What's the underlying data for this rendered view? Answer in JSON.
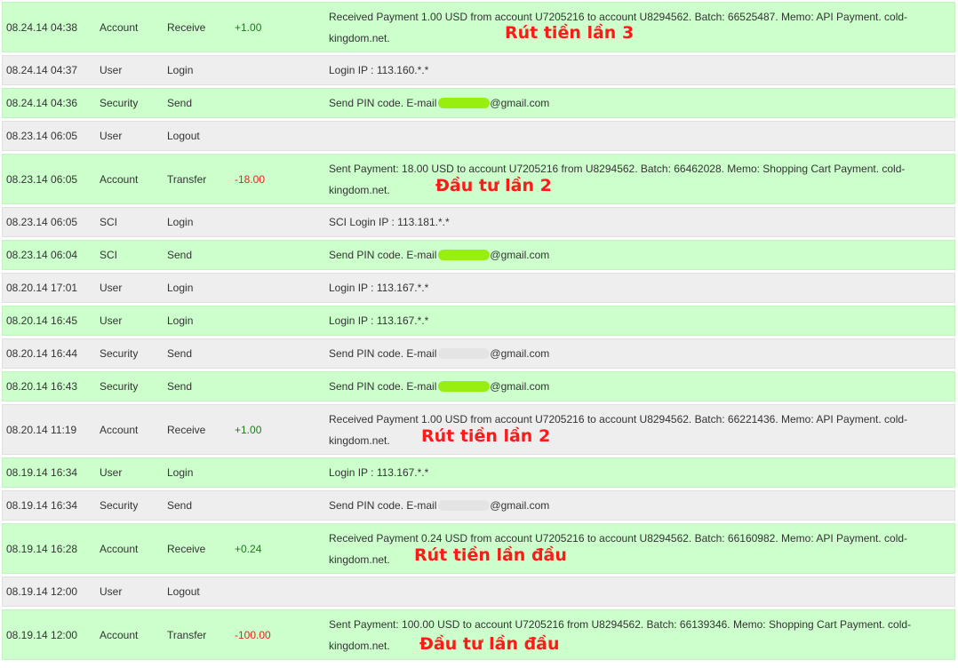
{
  "rows": [
    {
      "date": "08.24.14 04:38",
      "type": "Account",
      "action": "Receive",
      "amount": "+1.00",
      "amount_sign": "pos",
      "line1": "Received Payment 1.00 USD from account U7205216 to account U8294562. Batch: 66525487. Memo: API Payment. cold-",
      "line2": "kingdom.net.",
      "note": "Rút tiền lần 3"
    },
    {
      "date": "08.24.14 04:37",
      "type": "User",
      "action": "Login",
      "amount": "",
      "desc": "Login IP : 113.160.*.*"
    },
    {
      "date": "08.24.14 04:36",
      "type": "Security",
      "action": "Send",
      "amount": "",
      "desc_prefix": "Send PIN code. E-mail ",
      "desc_suffix": "@gmail.com"
    },
    {
      "date": "08.23.14 06:05",
      "type": "User",
      "action": "Logout",
      "amount": "",
      "desc": ""
    },
    {
      "date": "08.23.14 06:05",
      "type": "Account",
      "action": "Transfer",
      "amount": "-18.00",
      "amount_sign": "neg",
      "line1": "Sent Payment: 18.00 USD to account U7205216 from U8294562. Batch: 66462028. Memo: Shopping Cart Payment. cold-",
      "line2": "kingdom.net.",
      "note": "Đầu tư lần 2"
    },
    {
      "date": "08.23.14 06:05",
      "type": "SCI",
      "action": "Login",
      "amount": "",
      "desc": "SCI Login IP : 113.181.*.*"
    },
    {
      "date": "08.23.14 06:04",
      "type": "SCI",
      "action": "Send",
      "amount": "",
      "desc_prefix": "Send PIN code. E-mail ",
      "desc_suffix": "@gmail.com"
    },
    {
      "date": "08.20.14 17:01",
      "type": "User",
      "action": "Login",
      "amount": "",
      "desc": "Login IP : 113.167.*.*"
    },
    {
      "date": "08.20.14 16:45",
      "type": "User",
      "action": "Login",
      "amount": "",
      "desc": "Login IP : 113.167.*.*"
    },
    {
      "date": "08.20.14 16:44",
      "type": "Security",
      "action": "Send",
      "amount": "",
      "desc_prefix": "Send PIN code. E-mail ",
      "desc_suffix": "@gmail.com"
    },
    {
      "date": "08.20.14 16:43",
      "type": "Security",
      "action": "Send",
      "amount": "",
      "desc_prefix": "Send PIN code. E-mail ",
      "desc_suffix": "@gmail.com"
    },
    {
      "date": "08.20.14 11:19",
      "type": "Account",
      "action": "Receive",
      "amount": "+1.00",
      "amount_sign": "pos",
      "line1": "Received Payment 1.00 USD from account U7205216 to account U8294562. Batch: 66221436. Memo: API Payment. cold-",
      "line2": "kingdom.net.",
      "note": "Rút tiền lần 2"
    },
    {
      "date": "08.19.14 16:34",
      "type": "User",
      "action": "Login",
      "amount": "",
      "desc": "Login IP : 113.167.*.*"
    },
    {
      "date": "08.19.14 16:34",
      "type": "Security",
      "action": "Send",
      "amount": "",
      "desc_prefix": "Send PIN code. E-mail ",
      "desc_suffix": "@gmail.com"
    },
    {
      "date": "08.19.14 16:28",
      "type": "Account",
      "action": "Receive",
      "amount": "+0.24",
      "amount_sign": "pos",
      "line1": "Received Payment 0.24 USD from account U7205216 to account U8294562. Batch: 66160982. Memo: API Payment. cold-",
      "line2": "kingdom.net.",
      "note": "Rút tiền lần đầu"
    },
    {
      "date": "08.19.14 12:00",
      "type": "User",
      "action": "Logout",
      "amount": "",
      "desc": ""
    },
    {
      "date": "08.19.14 12:00",
      "type": "Account",
      "action": "Transfer",
      "amount": "-100.00",
      "amount_sign": "neg",
      "line1": "Sent Payment: 100.00 USD to account U7205216 from U8294562. Batch: 66139346. Memo: Shopping Cart Payment. cold-",
      "line2": "kingdom.net.",
      "note": "Đầu tư lần đầu"
    }
  ],
  "colors": {
    "row_green": "#ccffcc",
    "row_gray": "#eeeeee",
    "positive_amount": "#227722",
    "negative_amount": "#ee2222",
    "annotation": "#ff1a1a",
    "redaction": "#99ee11"
  }
}
